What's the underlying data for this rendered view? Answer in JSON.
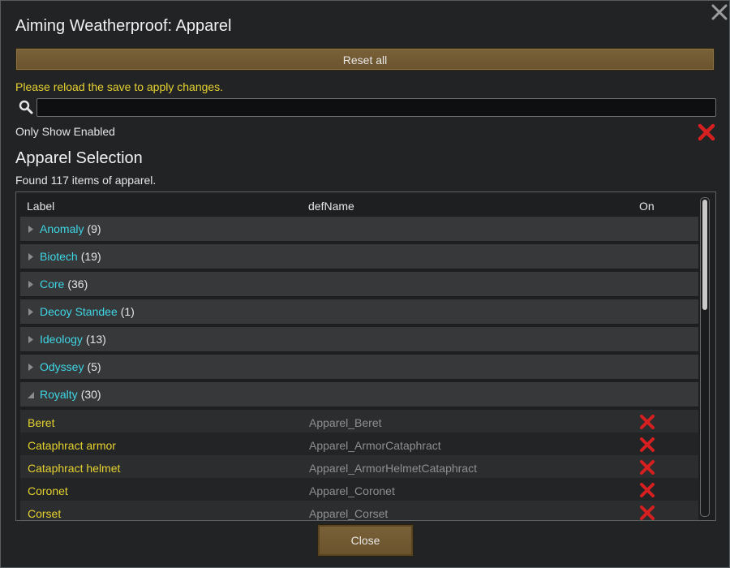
{
  "window": {
    "title": "Aiming Weatherproof: Apparel",
    "reset_label": "Reset all",
    "reload_message": "Please reload the save to apply changes.",
    "search_value": "",
    "only_enabled_label": "Only Show Enabled",
    "only_enabled_state": "off",
    "section_title": "Apparel Selection",
    "found_text": "Found 117 items of apparel.",
    "close_label": "Close"
  },
  "table": {
    "headers": {
      "label": "Label",
      "defname": "defName",
      "on": "On"
    },
    "groups": [
      {
        "name": "Anomaly",
        "count": "(9)",
        "expanded": false
      },
      {
        "name": "Biotech",
        "count": "(19)",
        "expanded": false
      },
      {
        "name": "Core",
        "count": "(36)",
        "expanded": false
      },
      {
        "name": "Decoy Standee",
        "count": "(1)",
        "expanded": false
      },
      {
        "name": "Ideology",
        "count": "(13)",
        "expanded": false
      },
      {
        "name": "Odyssey",
        "count": "(5)",
        "expanded": false
      },
      {
        "name": "Royalty",
        "count": "(30)",
        "expanded": true
      }
    ],
    "items": [
      {
        "label": "Beret",
        "defname": "Apparel_Beret",
        "on": false
      },
      {
        "label": "Cataphract armor",
        "defname": "Apparel_ArmorCataphract",
        "on": false
      },
      {
        "label": "Cataphract helmet",
        "defname": "Apparel_ArmorHelmetCataphract",
        "on": false
      },
      {
        "label": "Coronet",
        "defname": "Apparel_Coronet",
        "on": false
      },
      {
        "label": "Corset",
        "defname": "Apparel_Corset",
        "on": false
      }
    ]
  },
  "colors": {
    "group_name": "#3fd6e6",
    "item_label": "#e6d230",
    "defname": "#8d8f91",
    "off_icon": "#d62020",
    "button": "#7a6138"
  },
  "icons": {
    "close": "close-icon",
    "search": "search-icon",
    "toggle_off": "red-x-icon",
    "collapsed": "triangle-right-icon",
    "expanded": "triangle-down-icon"
  }
}
